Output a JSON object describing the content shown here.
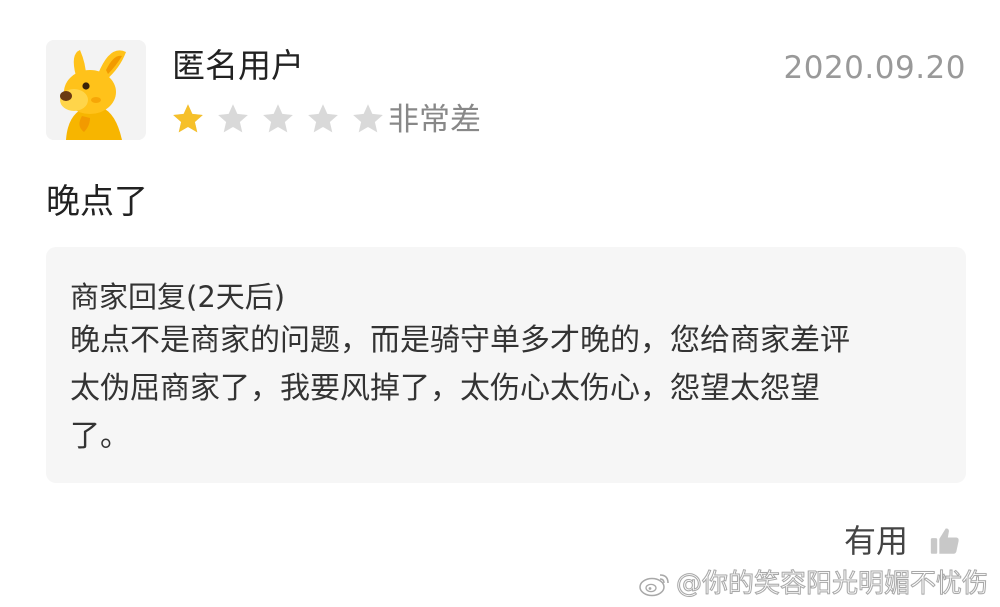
{
  "review": {
    "username": "匿名用户",
    "date": "2020.09.20",
    "rating": {
      "value": 1,
      "max": 5,
      "label": "非常差"
    },
    "colors": {
      "star_filled": "#F6C02A",
      "star_empty": "#D9D9D9",
      "avatar_accent": "#F7B500"
    },
    "avatar_icon": "kangaroo-mascot-icon",
    "text": "晚点了"
  },
  "reply": {
    "title": "商家回复(2天后)",
    "lines": [
      "晚点不是商家的问题，而是骑守单多才晚的，您给商家差评",
      "太伪屈商家了，我要风掉了，太伤心太伤心，怨望太怨望",
      "了。"
    ]
  },
  "actions": {
    "useful_label": "有用",
    "useful_icon": "thumbs-up-icon"
  },
  "watermark": {
    "text": "@你的笑容阳光明媚不忧伤",
    "icon": "weibo-logo-icon"
  }
}
